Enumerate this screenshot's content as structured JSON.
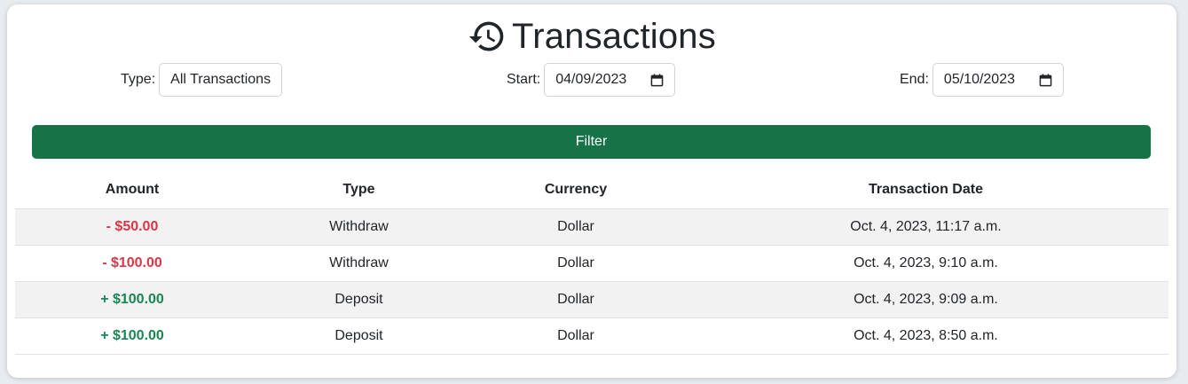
{
  "header": {
    "title": "Transactions",
    "icon": "history-icon"
  },
  "filters": {
    "type_label": "Type:",
    "type_value": "All Transactions",
    "start_label": "Start:",
    "start_value": "04/09/2023",
    "end_label": "End:",
    "end_value": "05/10/2023",
    "button_label": "Filter"
  },
  "table": {
    "columns": [
      "Amount",
      "Type",
      "Currency",
      "Transaction Date"
    ],
    "rows": [
      {
        "amount": "- $50.00",
        "type": "Withdraw",
        "currency": "Dollar",
        "date": "Oct. 4, 2023, 11:17 a.m.",
        "sign": "negative"
      },
      {
        "amount": "- $100.00",
        "type": "Withdraw",
        "currency": "Dollar",
        "date": "Oct. 4, 2023, 9:10 a.m.",
        "sign": "negative"
      },
      {
        "amount": "+ $100.00",
        "type": "Deposit",
        "currency": "Dollar",
        "date": "Oct. 4, 2023, 9:09 a.m.",
        "sign": "positive"
      },
      {
        "amount": "+ $100.00",
        "type": "Deposit",
        "currency": "Dollar",
        "date": "Oct. 4, 2023, 8:50 a.m.",
        "sign": "positive"
      }
    ]
  },
  "colors": {
    "primary_button": "#157347",
    "negative": "#dc3545",
    "positive": "#198754",
    "row_stripe": "#f2f2f2"
  }
}
